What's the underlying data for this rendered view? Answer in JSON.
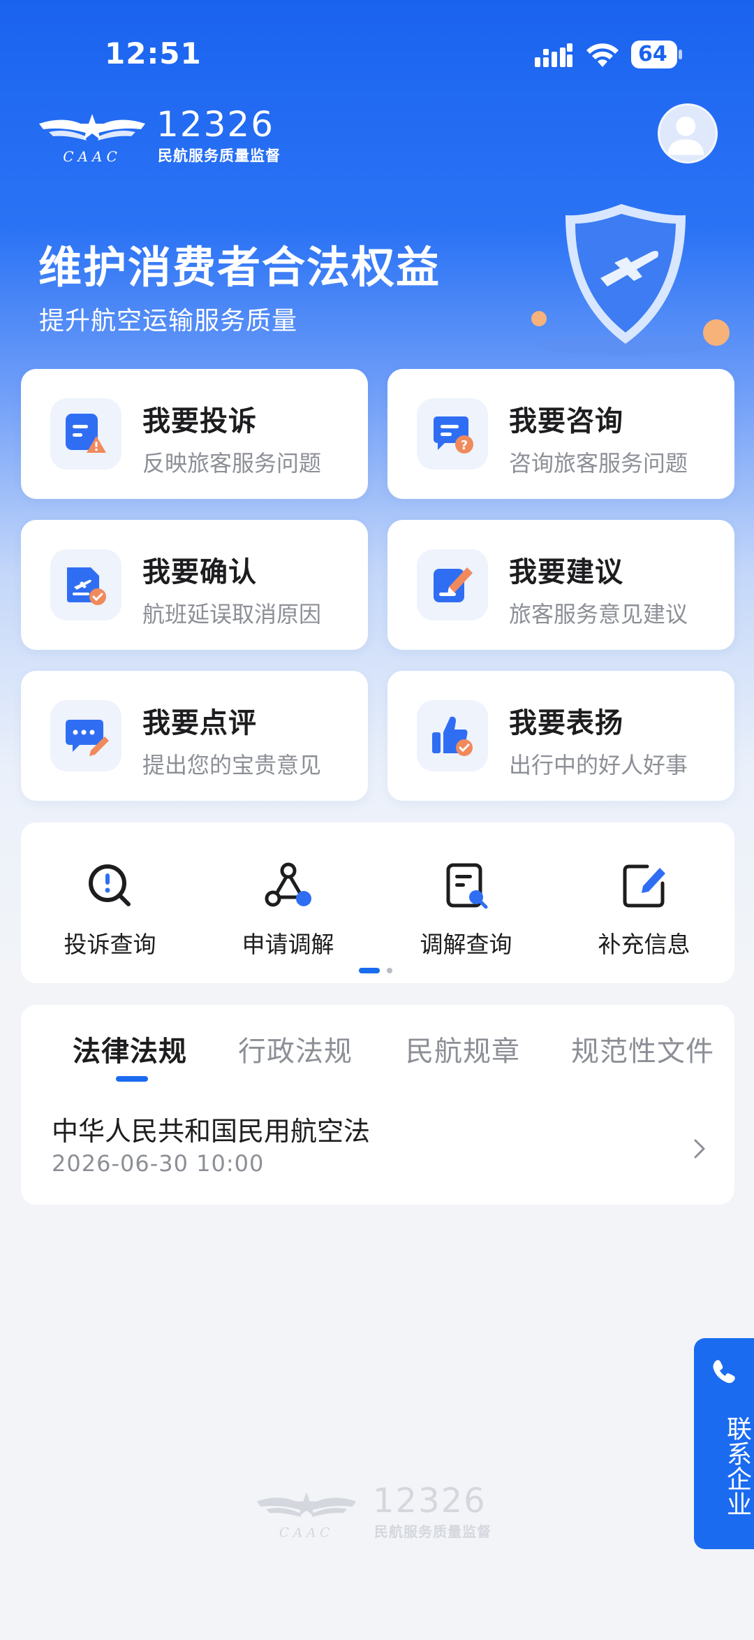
{
  "status_bar": {
    "time": "12:51",
    "battery": "64"
  },
  "header": {
    "logo_number": "12326",
    "logo_subtitle": "民航服务质量监督",
    "logo_mark_text": "CAAC"
  },
  "hero": {
    "title": "维护消费者合法权益",
    "subtitle": "提升航空运输服务质量"
  },
  "cards": [
    {
      "title": "我要投诉",
      "desc": "反映旅客服务问题"
    },
    {
      "title": "我要咨询",
      "desc": "咨询旅客服务问题"
    },
    {
      "title": "我要确认",
      "desc": "航班延误取消原因"
    },
    {
      "title": "我要建议",
      "desc": "旅客服务意见建议"
    },
    {
      "title": "我要点评",
      "desc": "提出您的宝贵意见"
    },
    {
      "title": "我要表扬",
      "desc": "出行中的好人好事"
    }
  ],
  "quick_services": [
    {
      "label": "投诉查询"
    },
    {
      "label": "申请调解"
    },
    {
      "label": "调解查询"
    },
    {
      "label": "补充信息"
    }
  ],
  "regulations": {
    "tabs": [
      "法律法规",
      "行政法规",
      "民航规章",
      "规范性文件"
    ],
    "items": [
      {
        "title": "中华人民共和国民用航空法",
        "date": "2026-06-30 10:00"
      }
    ]
  },
  "contact": {
    "label": "联系企业"
  },
  "footer": {
    "logo_number": "12326",
    "logo_subtitle": "民航服务质量监督",
    "logo_mark_text": "CAAC"
  },
  "colors": {
    "primary": "#1a6bf0",
    "hero_blue": "#1a63ef",
    "text": "#1d1d1f",
    "muted": "#8c8f96",
    "warn": "#f08a5d"
  }
}
